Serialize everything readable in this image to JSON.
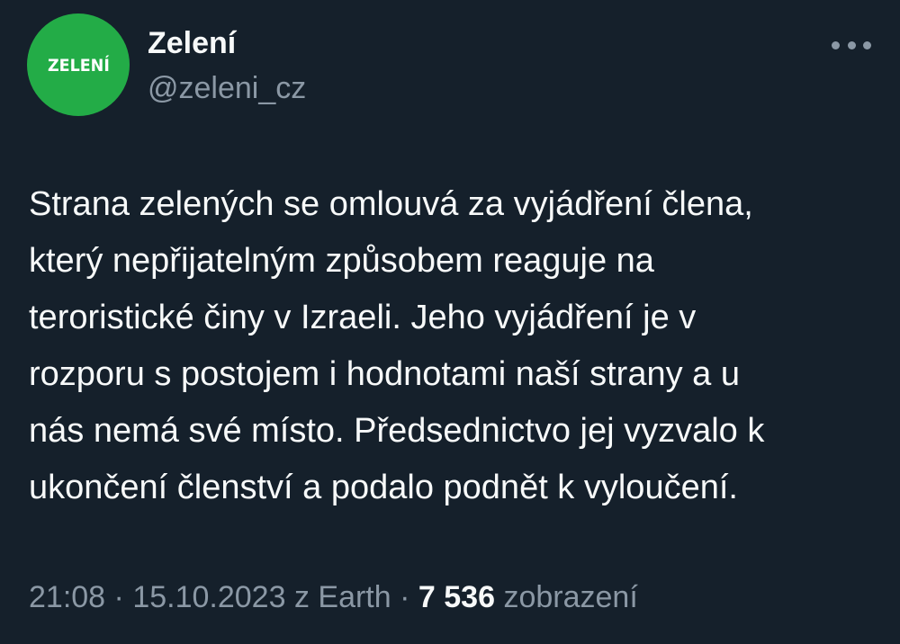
{
  "tweet": {
    "avatar": {
      "logo_text": "ZELENÍ",
      "bg_color": "#23ac47"
    },
    "author": {
      "display_name": "Zelení",
      "handle": "@zeleni_cz"
    },
    "more_icon": "more-horizontal-icon",
    "body_lines": [
      "Strana zelených se omlouvá za vyjádření člena,",
      "který nepřijatelným způsobem reaguje na",
      "teroristické činy v Izraeli. Jeho vyjádření je v",
      "rozporu s postojem i hodnotami naší strany a u",
      "nás nemá své místo. Předsednictvo jej vyzvalo k",
      "ukončení členství a podalo podnět k vyloučení."
    ],
    "meta": {
      "time": "21:08",
      "separator": "·",
      "date": "15.10.2023",
      "source": "z Earth",
      "views_count": "7 536",
      "views_label": "zobrazení"
    }
  },
  "colors": {
    "background": "#15202b",
    "primary_text": "#f7f9f9",
    "secondary_text": "#8b98a5"
  }
}
